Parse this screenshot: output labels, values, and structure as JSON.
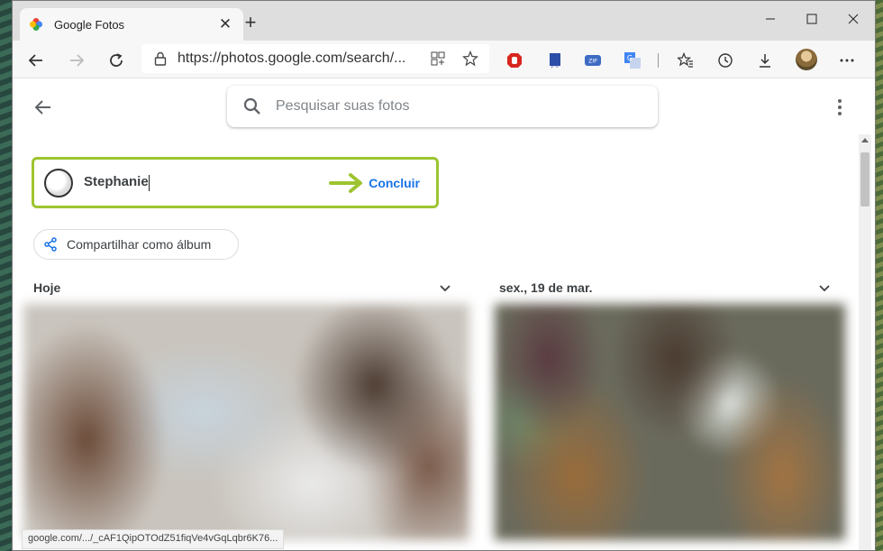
{
  "browser": {
    "tab_title": "Google Fotos",
    "tab_close": "✕",
    "new_tab": "+",
    "address": "https://photos.google.com/search/...",
    "status_url": "google.com/.../_cAF1QipOTOdZ51fiqVe4vGqLqbr6K76..."
  },
  "search": {
    "placeholder": "Pesquisar suas fotos"
  },
  "person": {
    "name": "Stephanie",
    "done_label": "Concluir",
    "accent": "#9dc430"
  },
  "share": {
    "label": "Compartilhar como álbum"
  },
  "sections": [
    {
      "date": "Hoje"
    },
    {
      "date": "sex., 19 de mar."
    }
  ],
  "colors": {
    "link": "#1a73e8",
    "text": "#3c4043"
  }
}
